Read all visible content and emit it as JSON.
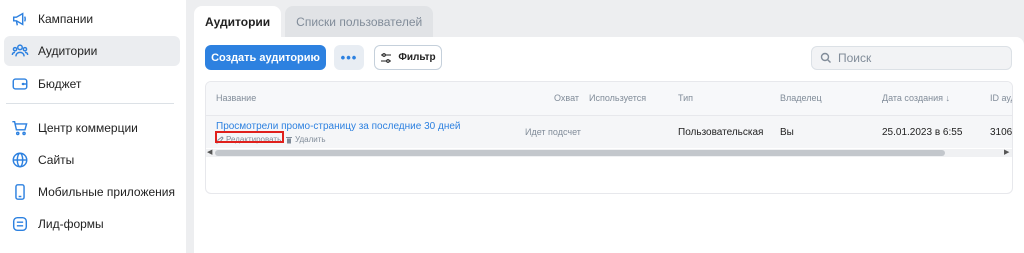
{
  "sidebar": {
    "items": [
      {
        "label": "Кампании",
        "icon": "megaphone-icon"
      },
      {
        "label": "Аудитории",
        "icon": "audiences-icon",
        "active": true
      },
      {
        "label": "Бюджет",
        "icon": "wallet-icon"
      },
      {
        "label": "Центр коммерции",
        "icon": "cart-icon"
      },
      {
        "label": "Сайты",
        "icon": "globe-icon"
      },
      {
        "label": "Мобильные приложения",
        "icon": "phone-icon"
      },
      {
        "label": "Лид-формы",
        "icon": "form-icon"
      }
    ]
  },
  "tabs": [
    {
      "label": "Аудитории",
      "active": true
    },
    {
      "label": "Списки пользователей",
      "active": false
    }
  ],
  "toolbar": {
    "create_label": "Создать аудиторию",
    "more_label": "•••",
    "filter_label": "Фильтр",
    "search_placeholder": "Поиск"
  },
  "table": {
    "headers": {
      "name": "Название",
      "reach": "Охват",
      "used": "Используется",
      "type": "Тип",
      "owner": "Владелец",
      "created": "Дата создания ↓",
      "id": "ID ауд"
    },
    "rows": [
      {
        "name": "Просмотрели промо-страницу за последние 30 дней",
        "edit_label": "Редактировать",
        "delete_label": "Удалить",
        "reach": "Идет подсчет",
        "type": "Пользовательская",
        "owner": "Вы",
        "created": "25.01.2023 в 6:55",
        "id": "3106"
      }
    ]
  },
  "colors": {
    "accent": "#2d81e0",
    "highlight": "#e0201c"
  }
}
